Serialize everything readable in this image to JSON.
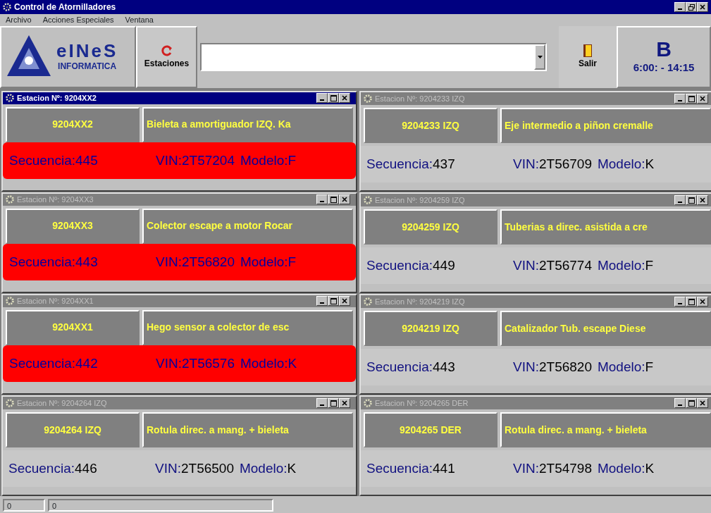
{
  "window": {
    "title": "Control de Atornilladores"
  },
  "menu": [
    "Archivo",
    "Acciones Especiales",
    "Ventana"
  ],
  "toolbar": {
    "logo_name": "eINeS",
    "logo_sub": "INFORMATICA",
    "stations_button": "Estaciones",
    "exit_button": "Salir",
    "shift": "B",
    "shift_hours": "6:00: - 14:15"
  },
  "stations": [
    {
      "title": "Estacion Nº: 9204XX2",
      "active": true,
      "code": "9204XX2",
      "description": "Bieleta a amortiguador IZQ. Ka",
      "alert": true,
      "sequence_label": "Secuencia:",
      "sequence": "445",
      "vin_label": "VIN:",
      "vin": "2T57204",
      "model_label": "Modelo:",
      "model": "F"
    },
    {
      "title": "Estacion Nº: 9204233 IZQ",
      "active": false,
      "code": "9204233 IZQ",
      "description": "Eje intermedio a piñon cremalle",
      "alert": false,
      "sequence_label": "Secuencia:",
      "sequence": "437",
      "vin_label": "VIN:",
      "vin": "2T56709",
      "model_label": "Modelo:",
      "model": "K"
    },
    {
      "title": "Estacion Nº: 9204XX3",
      "active": false,
      "code": "9204XX3",
      "description": "Colector escape a motor Rocar",
      "alert": true,
      "sequence_label": "Secuencia:",
      "sequence": "443",
      "vin_label": "VIN:",
      "vin": "2T56820",
      "model_label": "Modelo:",
      "model": "F"
    },
    {
      "title": "Estacion Nº: 9204259 IZQ",
      "active": false,
      "code": "9204259 IZQ",
      "description": "Tuberias a direc. asistida a cre",
      "alert": false,
      "sequence_label": "Secuencia:",
      "sequence": "449",
      "vin_label": "VIN:",
      "vin": "2T56774",
      "model_label": "Modelo:",
      "model": "F"
    },
    {
      "title": "Estacion Nº: 9204XX1",
      "active": false,
      "code": "9204XX1",
      "description": "Hego sensor a colector de esc",
      "alert": true,
      "sequence_label": "Secuencia:",
      "sequence": "442",
      "vin_label": "VIN:",
      "vin": "2T56576",
      "model_label": "Modelo:",
      "model": "K"
    },
    {
      "title": "Estacion Nº: 9204219 IZQ",
      "active": false,
      "code": "9204219 IZQ",
      "description": "Catalizador Tub. escape Diese",
      "alert": false,
      "sequence_label": "Secuencia:",
      "sequence": "443",
      "vin_label": "VIN:",
      "vin": "2T56820",
      "model_label": "Modelo:",
      "model": "F"
    },
    {
      "title": "Estacion Nº: 9204264 IZQ",
      "active": false,
      "code": "9204264 IZQ",
      "description": "Rotula direc. a mang. + bieleta",
      "alert": false,
      "sequence_label": "Secuencia:",
      "sequence": "446",
      "vin_label": "VIN:",
      "vin": "2T56500",
      "model_label": "Modelo:",
      "model": "K"
    },
    {
      "title": "Estacion Nº: 9204265 DER",
      "active": false,
      "code": "9204265 DER",
      "description": "Rotula direc. a mang. + bieleta",
      "alert": false,
      "sequence_label": "Secuencia:",
      "sequence": "441",
      "vin_label": "VIN:",
      "vin": "2T54798",
      "model_label": "Modelo:",
      "model": "K"
    }
  ],
  "status_bar": [
    "0",
    "0"
  ]
}
